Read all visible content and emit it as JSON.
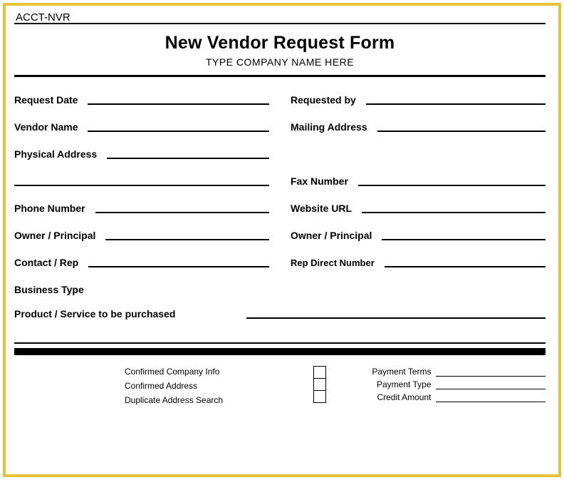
{
  "form_id": "ACCT-NVR",
  "title": "New Vendor Request Form",
  "company_placeholder": "TYPE COMPANY NAME HERE",
  "fields": {
    "request_date": "Request Date",
    "requested_by": "Requested by",
    "vendor_name": "Vendor Name",
    "mailing_address": "Mailing Address",
    "physical_address": "Physical Address",
    "fax_number": "Fax Number",
    "phone_number": "Phone Number",
    "website_url": "Website URL",
    "owner_principal_1": "Owner / Principal",
    "owner_principal_2": "Owner / Principal",
    "contact_rep": "Contact  / Rep",
    "rep_direct_number": "Rep Direct Number",
    "business_type": "Business Type",
    "product_service": "Product / Service to be purchased"
  },
  "confirm": {
    "company_info": "Confirmed Company Info",
    "address": "Confirmed Address",
    "dup_search": "Duplicate Address Search"
  },
  "payment": {
    "terms": "Payment Terms",
    "type": "Payment Type",
    "credit": "Credit Amount"
  }
}
